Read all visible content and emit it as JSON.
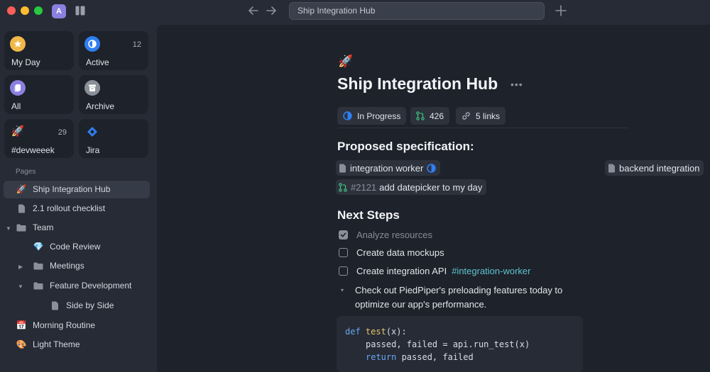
{
  "titlebar": {
    "workspace_initial": "A",
    "search_value": "Ship Integration Hub"
  },
  "sidebar": {
    "tiles": [
      {
        "label": "My Day",
        "count": "",
        "icon": "star-icon",
        "color": "#f0b84a"
      },
      {
        "label": "Active",
        "count": "12",
        "icon": "half-circle-icon",
        "color": "#2f7ff2"
      },
      {
        "label": "All",
        "count": "",
        "icon": "pages-icon",
        "color": "#8b7fe0"
      },
      {
        "label": "Archive",
        "count": "",
        "icon": "archive-icon",
        "color": "#8a909a"
      },
      {
        "label": "#devweeek",
        "count": "29",
        "icon": "rocket-emoji",
        "color": ""
      },
      {
        "label": "Jira",
        "count": "",
        "icon": "jira-icon",
        "color": "#2f7ff2"
      }
    ],
    "pages_header": "Pages",
    "pages": [
      {
        "label": "Ship Integration Hub",
        "icon": "rocket-emoji"
      },
      {
        "label": "2.1 rollout checklist",
        "icon": "document-icon"
      },
      {
        "label": "Team",
        "icon": "folder-icon"
      },
      {
        "label": "Code Review",
        "icon": "gem-emoji"
      },
      {
        "label": "Meetings",
        "icon": "folder-icon"
      },
      {
        "label": "Feature Development",
        "icon": "folder-icon"
      },
      {
        "label": "Side by Side",
        "icon": "document-icon"
      },
      {
        "label": "Morning Routine",
        "icon": "calendar-emoji"
      },
      {
        "label": "Light Theme",
        "icon": "palette-emoji"
      }
    ]
  },
  "page": {
    "emoji": "🚀",
    "title": "Ship Integration Hub",
    "more": "•••",
    "status": "In Progress",
    "pr_count": "426",
    "links": "5 links",
    "spec_heading": "Proposed specification:",
    "mentions": [
      "integration worker",
      "backend integration"
    ],
    "pr_ref": "#2121",
    "pr_title": "add datepicker to my day",
    "next_heading": "Next Steps",
    "todos": [
      {
        "text": "Analyze resources",
        "done": true,
        "tag": ""
      },
      {
        "text": "Create data mockups",
        "done": false,
        "tag": ""
      },
      {
        "text": "Create integration API",
        "done": false,
        "tag": "#integration-worker"
      }
    ],
    "paragraph": "Check out PiedPiper's preloading features today to optimize our app's performance.",
    "code": {
      "line1_kw": "def",
      "line1_fn": "test",
      "line1_rest": "(x):",
      "line2": "passed, failed = api.run_test(x)",
      "line3_kw": "return",
      "line3_rest": " passed, failed"
    }
  },
  "colors": {
    "accent_blue": "#2f7ff2",
    "tag_teal": "#5ec4cf",
    "pr_green": "#3fb97a"
  }
}
